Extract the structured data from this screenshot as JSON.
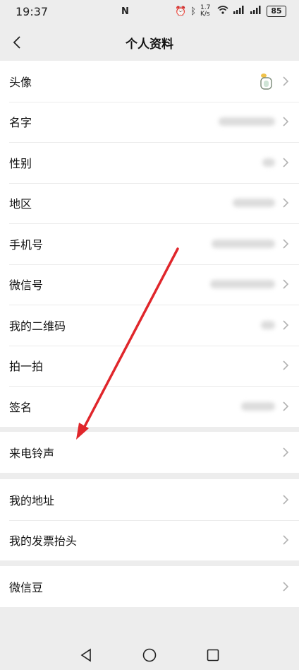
{
  "status": {
    "time": "19:37",
    "nfc": "N",
    "speed": "1.7 K/s",
    "battery": "85"
  },
  "header": {
    "title": "个人资料"
  },
  "profile_group": [
    {
      "label": "头像"
    },
    {
      "label": "名字"
    },
    {
      "label": "性别"
    },
    {
      "label": "地区"
    },
    {
      "label": "手机号"
    },
    {
      "label": "微信号"
    },
    {
      "label": "我的二维码"
    },
    {
      "label": "拍一拍"
    },
    {
      "label": "签名"
    }
  ],
  "ringtone_group": [
    {
      "label": "来电铃声"
    }
  ],
  "address_group": [
    {
      "label": "我的地址"
    },
    {
      "label": "我的发票抬头"
    }
  ],
  "beans_group": [
    {
      "label": "微信豆"
    }
  ],
  "icons": {
    "back": "chevron-left-icon",
    "row_arrow": "chevron-right-icon",
    "sys_back": "triangle-back-icon",
    "sys_home": "circle-home-icon",
    "sys_recent": "square-recent-icon"
  },
  "colors": {
    "background": "#ededed",
    "row_bg": "#ffffff",
    "annotation_arrow": "#e0262b"
  }
}
